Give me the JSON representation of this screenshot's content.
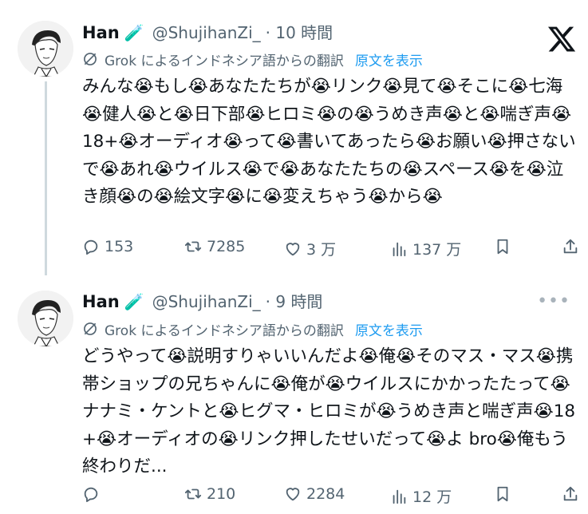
{
  "tweets": [
    {
      "name": "Han",
      "badge": "🧪",
      "handle": "@ShujihanZi_",
      "time": "· 10 時間",
      "translation_label": "Grok によるインドネシア語からの翻訳",
      "show_original": "原文を表示",
      "text": "みんな😭もし😭あなたたちが😭リンク😭見て😭そこに😭七海😭健人😭と😭日下部😭ヒロミ😭の😭うめき声😭と😭喘ぎ声😭18+😭オーディオ😭って😭書いてあったら😭お願い😭押さないで😭あれ😭ウイルス😭で😭あなたたちの😭スペース😭を😭泣き顔😭の😭絵文字😭に😭変えちゃう😭から😭",
      "replies": "153",
      "reposts": "7285",
      "likes": "3 万",
      "views": "137 万"
    },
    {
      "name": "Han",
      "badge": "🧪",
      "handle": "@ShujihanZi_",
      "time": "· 9 時間",
      "more": "•••",
      "translation_label": "Grok によるインドネシア語からの翻訳",
      "show_original": "原文を表示",
      "text": "どうやって😭説明すりゃいいんだよ😭俺😭そのマス・マス😭携帯ショップの兄ちゃんに😭俺が😭ウイルスにかかったたって😭ナナミ・ケントと😭ヒグマ・ヒロミが😭うめき声と喘ぎ声😭18+😭オーディオの😭リンク押したせいだって😭よ bro😭俺もう終わりだ...",
      "reposts": "210",
      "likes": "2284",
      "views": "12 万"
    }
  ]
}
